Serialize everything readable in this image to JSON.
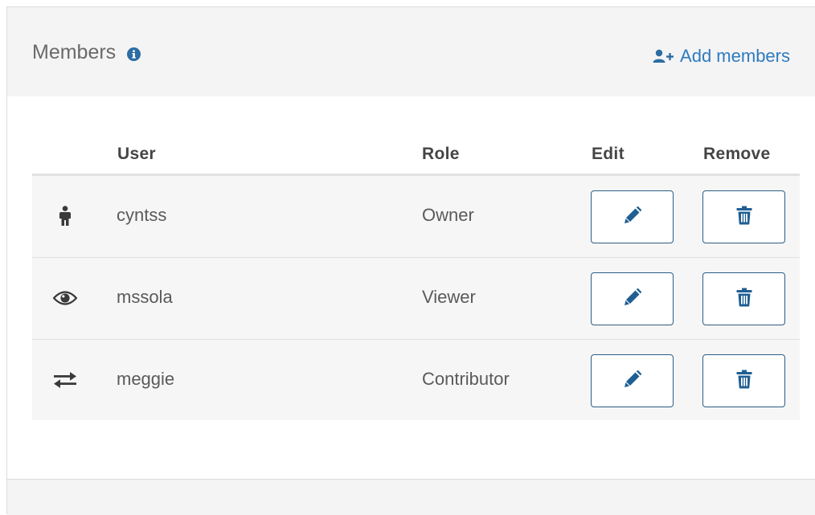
{
  "panel": {
    "title": "Members",
    "info_icon": "info-icon",
    "add_members_label": "Add members",
    "add_members_icon": "add-user-icon",
    "accent_color": "#2d7bbf"
  },
  "table": {
    "headers": {
      "user": "User",
      "role": "Role",
      "edit": "Edit",
      "remove": "Remove"
    },
    "rows": [
      {
        "icon": "person-icon",
        "user": "cyntss",
        "role": "Owner",
        "edit_icon": "pencil-icon",
        "remove_icon": "trash-icon"
      },
      {
        "icon": "eye-icon",
        "user": "mssola",
        "role": "Viewer",
        "edit_icon": "pencil-icon",
        "remove_icon": "trash-icon"
      },
      {
        "icon": "exchange-arrows-icon",
        "user": "meggie",
        "role": "Contributor",
        "edit_icon": "pencil-icon",
        "remove_icon": "trash-icon"
      }
    ]
  }
}
